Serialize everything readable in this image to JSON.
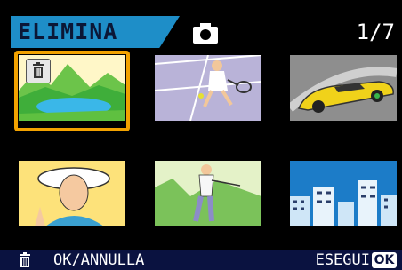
{
  "header": {
    "mode_label": "ELIMINA",
    "mode_icon": "camera-icon",
    "counter": "1/7"
  },
  "thumbnails": [
    {
      "name": "lake-mountains",
      "selected": true,
      "marked_for_delete": true
    },
    {
      "name": "tennis-player",
      "selected": false,
      "marked_for_delete": false
    },
    {
      "name": "yellow-sports-car",
      "selected": false,
      "marked_for_delete": false
    },
    {
      "name": "woman-with-hat",
      "selected": false,
      "marked_for_delete": false
    },
    {
      "name": "golfer",
      "selected": false,
      "marked_for_delete": false
    },
    {
      "name": "city-skyline",
      "selected": false,
      "marked_for_delete": false
    }
  ],
  "footer": {
    "left_icon": "trash-icon",
    "left_label": "OK/ANNULLA",
    "right_label": "ESEGUI",
    "ok_key_label": "OK"
  },
  "colors": {
    "tab": "#1e8ec8",
    "selection": "#f2a200",
    "footer_bg": "#0a1240"
  }
}
